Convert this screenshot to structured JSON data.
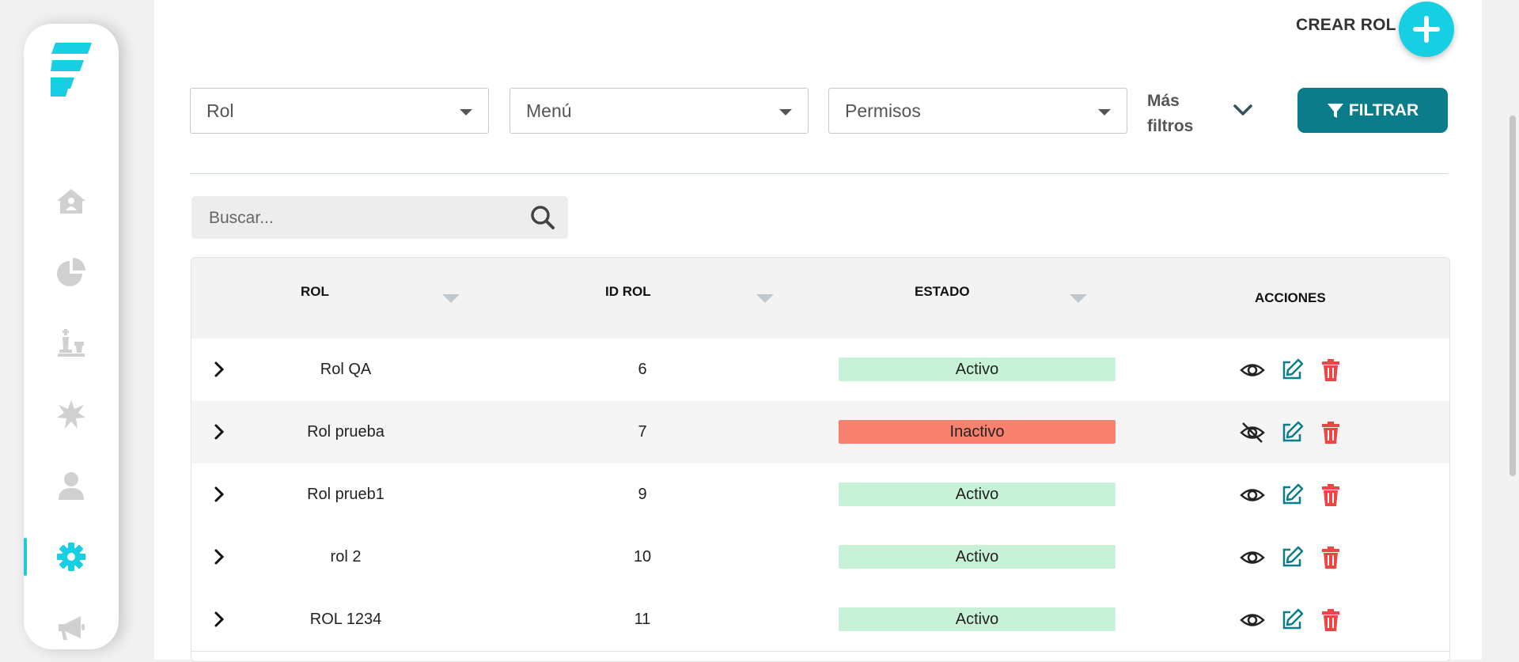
{
  "header": {
    "create_label": "CREAR ROL"
  },
  "filters": {
    "rol": "Rol",
    "menu": "Menú",
    "permisos": "Permisos",
    "more_line1": "Más",
    "more_line2": "filtros",
    "filter_button": "FILTRAR"
  },
  "search": {
    "placeholder": "Buscar..."
  },
  "table": {
    "columns": [
      "ROL",
      "ID ROL",
      "ESTADO",
      "ACCIONES"
    ],
    "rows": [
      {
        "rol": "Rol QA",
        "id": "6",
        "estado": "Activo",
        "status": "activo"
      },
      {
        "rol": "Rol prueba",
        "id": "7",
        "estado": "Inactivo",
        "status": "inactivo"
      },
      {
        "rol": "Rol prueb1",
        "id": "9",
        "estado": "Activo",
        "status": "activo"
      },
      {
        "rol": "rol 2",
        "id": "10",
        "estado": "Activo",
        "status": "activo"
      },
      {
        "rol": "ROL 1234",
        "id": "11",
        "estado": "Activo",
        "status": "activo"
      }
    ]
  },
  "sidebar": {
    "items": [
      "home-icon",
      "pie-chart-icon",
      "chess-icon",
      "burst-icon",
      "user-icon",
      "settings-icon",
      "megaphone-icon"
    ],
    "active": "settings-icon"
  },
  "colors": {
    "accent": "#17cfe3",
    "filter_button": "#0a7c8a",
    "active_badge": "#c8f2d8",
    "inactive_badge": "#f8806f",
    "delete_icon": "#ef4444",
    "edit_icon": "#0a7c8a"
  }
}
